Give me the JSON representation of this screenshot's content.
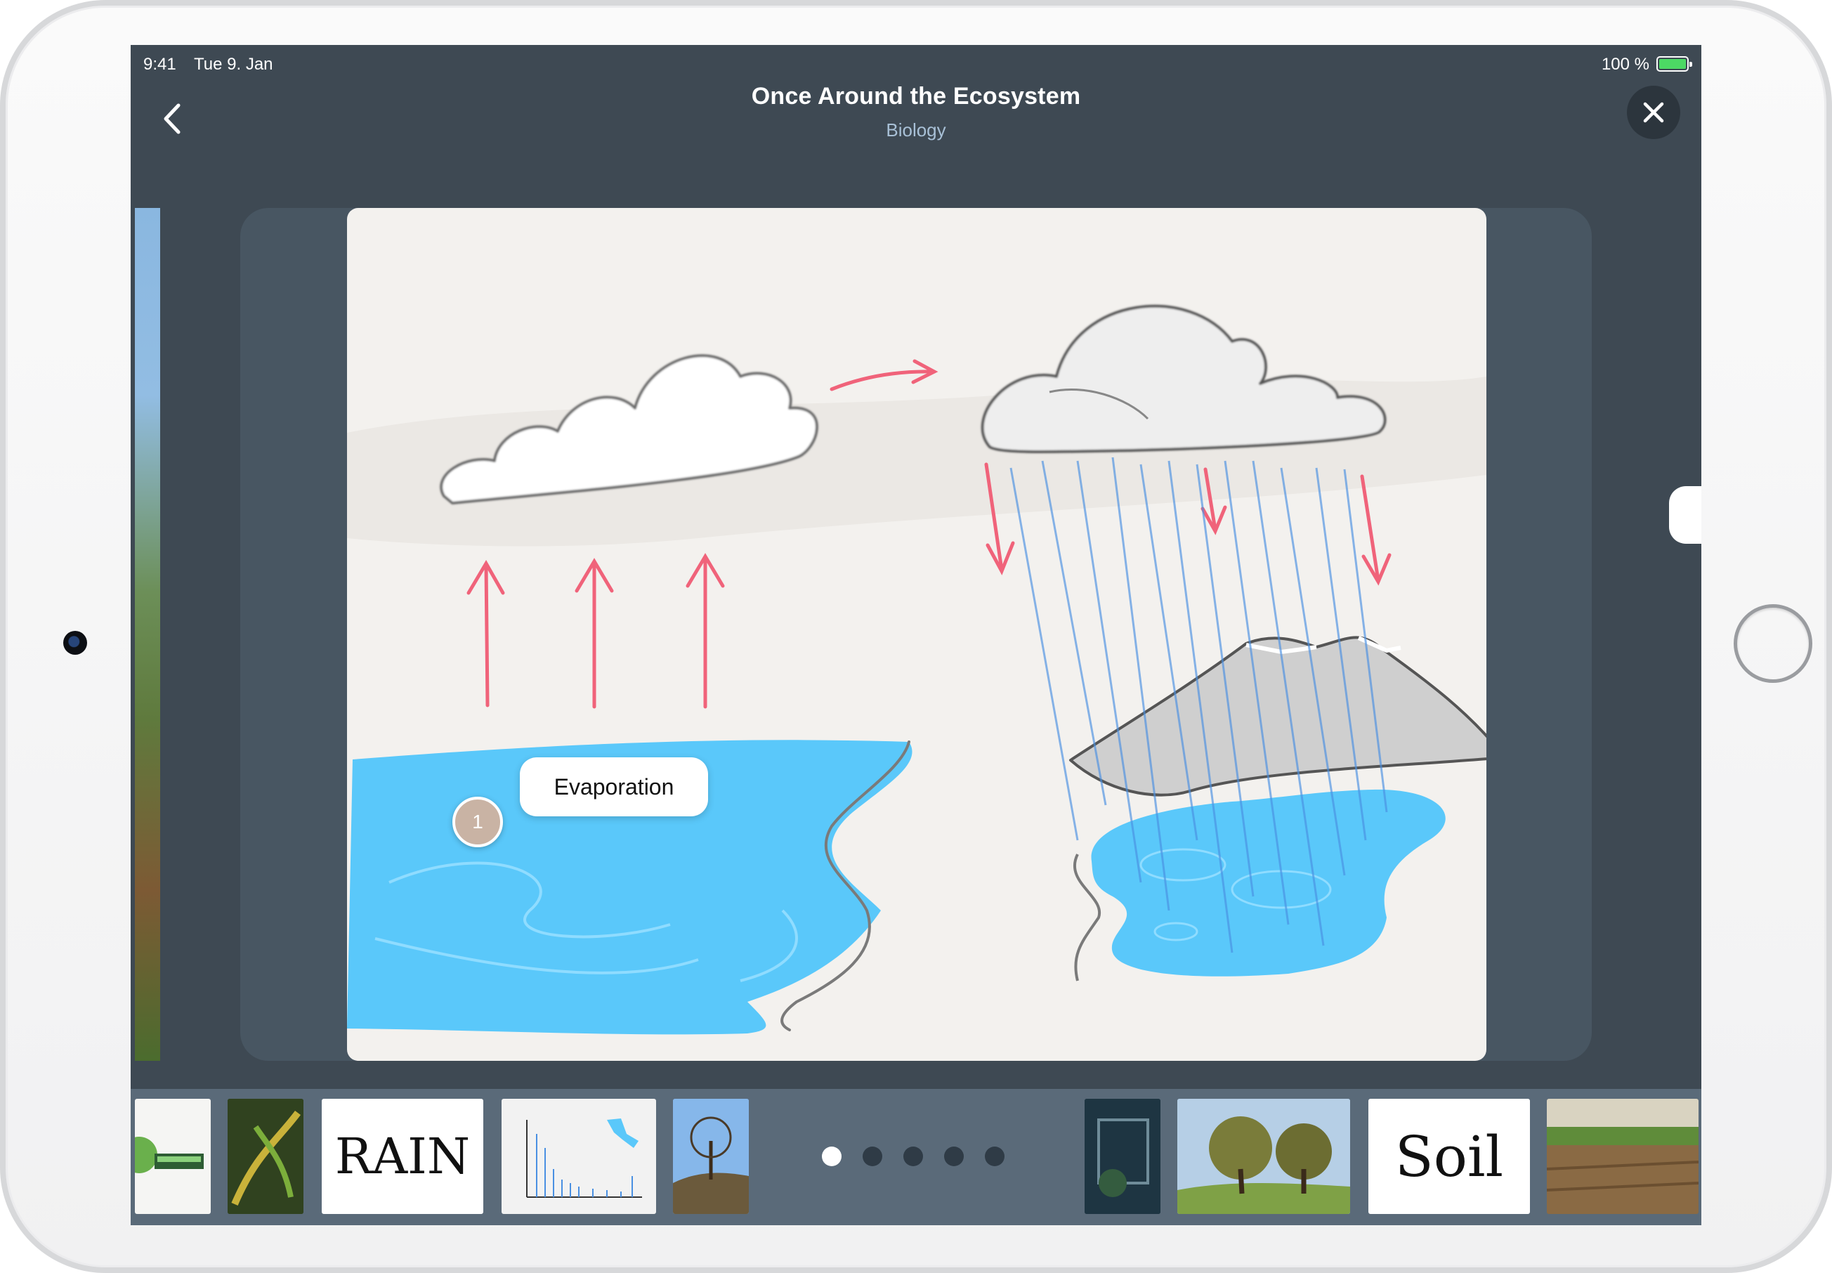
{
  "status_bar": {
    "time": "9:41",
    "date": "Tue 9. Jan",
    "battery_percent": "100 %",
    "battery_level": 1.0,
    "battery_color": "#4cd964"
  },
  "nav": {
    "back_icon": "chevron-left-icon",
    "title": "Once Around the Ecosystem",
    "subtitle": "Biology",
    "close_icon": "close-icon"
  },
  "slide": {
    "hotspot_number": "1",
    "callout_label": "Evaporation",
    "water_color": "#5ac8fa",
    "arrow_color": "#f0637a"
  },
  "thumbnails": [
    {
      "name": "thumb-logo-sign",
      "text": ""
    },
    {
      "name": "thumb-plant-closeup",
      "text": ""
    },
    {
      "name": "thumb-rain-drawing",
      "text": "RAIN"
    },
    {
      "name": "thumb-chart",
      "text": ""
    },
    {
      "name": "thumb-tree-hill",
      "text": ""
    },
    {
      "name": "thumb-greenhouse",
      "text": ""
    },
    {
      "name": "thumb-oak-trees",
      "text": ""
    },
    {
      "name": "thumb-soil-drawing",
      "text": "Soil"
    },
    {
      "name": "thumb-field-soil",
      "text": ""
    }
  ],
  "page_indicator": {
    "pages": 5,
    "current": 1
  }
}
